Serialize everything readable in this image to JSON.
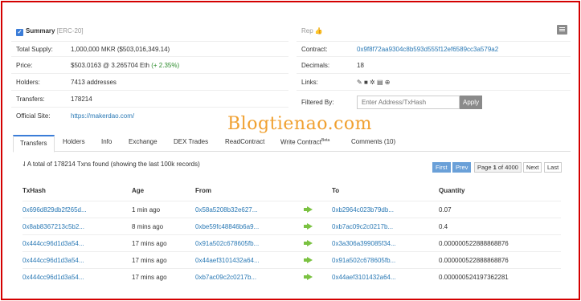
{
  "summary": {
    "title": "Summary",
    "subtitle": "[ERC-20]",
    "rows": [
      {
        "label": "Total Supply:",
        "value": "1,000,000 MKR ($503,016,349.14)"
      },
      {
        "label": "Price:",
        "value": "$503.0163 @ 3.265704 Eth",
        "change": "(+ 2.35%)"
      },
      {
        "label": "Holders:",
        "value": "7413 addresses"
      },
      {
        "label": "Transfers:",
        "value": "178214"
      },
      {
        "label": "Official Site:",
        "value": "https://makerdao.com/"
      }
    ]
  },
  "right": {
    "rep_label": "Rep",
    "contract_label": "Contract:",
    "contract_value": "0x9f8f72aa9304c8b593d555f12ef6589cc3a579a2",
    "decimals_label": "Decimals:",
    "decimals_value": "18",
    "links_label": "Links:",
    "filter_label": "Filtered By:",
    "filter_placeholder": "Enter Address/TxHash",
    "apply_label": "Apply"
  },
  "watermark": "Blogtienao.com",
  "tabs": [
    "Transfers",
    "Holders",
    "Info",
    "Exchange",
    "DEX Trades",
    "ReadContract",
    "Write Contract",
    "Comments (10)"
  ],
  "write_contract_sup": "Beta",
  "table": {
    "summary": "A total of 178214 Txns found (showing the last 100k records)",
    "pager": {
      "first": "First",
      "prev": "Prev",
      "page_text": "Page",
      "page": "1",
      "of_text": "of",
      "total": "4000",
      "next": "Next",
      "last": "Last"
    },
    "headers": [
      "TxHash",
      "Age",
      "From",
      "To",
      "Quantity"
    ],
    "rows": [
      {
        "hash": "0x696d829db2f265d...",
        "age": "1 min ago",
        "from": "0x58a5208b32e627...",
        "to": "0xb2964c023b79db...",
        "qty": "0.07"
      },
      {
        "hash": "0x8ab8367213c5b2...",
        "age": "8 mins ago",
        "from": "0xbe59fc48846b6a9...",
        "to": "0xb7ac09c2c0217b...",
        "qty": "0.4"
      },
      {
        "hash": "0x444cc96d1d3a54...",
        "age": "17 mins ago",
        "from": "0x91a502c678605fb...",
        "to": "0x3a306a399085f34...",
        "qty": "0.000000522888868876"
      },
      {
        "hash": "0x444cc96d1d3a54...",
        "age": "17 mins ago",
        "from": "0x44aef3101432a64...",
        "to": "0x91a502c678605fb...",
        "qty": "0.000000522888868876"
      },
      {
        "hash": "0x444cc96d1d3a54...",
        "age": "17 mins ago",
        "from": "0xb7ac09c2c0217b...",
        "to": "0x44aef3101432a64...",
        "qty": "0.000000524197362281"
      }
    ]
  },
  "colors": {
    "border": "#d40000",
    "link": "#2a79b5",
    "accent": "#3b7dd8",
    "green": "#2a8a2a"
  }
}
